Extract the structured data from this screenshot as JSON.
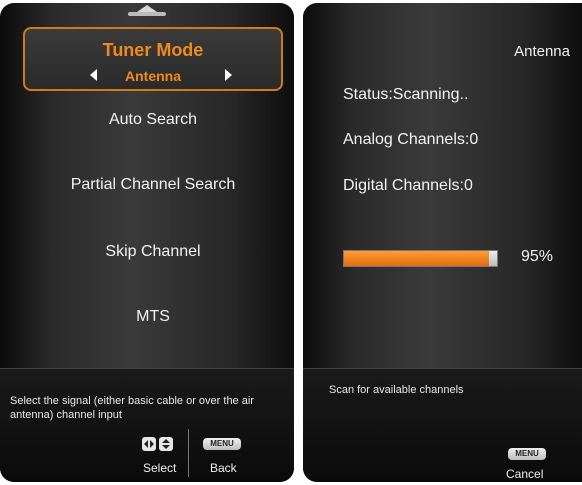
{
  "left_panel": {
    "tuner_mode": {
      "title": "Tuner Mode",
      "value": "Antenna"
    },
    "menu_items": [
      "Auto Search",
      "Partial Channel Search",
      "Skip Channel",
      "MTS"
    ],
    "help_text": "Select the signal (either basic cable or over the air antenna) channel input",
    "controls": {
      "select_label": "Select",
      "menu_key_label": "MENU",
      "back_label": "Back"
    }
  },
  "right_panel": {
    "title": "Antenna",
    "status_text": "Status:Scanning..",
    "analog_channels_text": "Analog Channels:0",
    "digital_channels_text": "Digital Channels:0",
    "progress": {
      "value_percent": 95,
      "label": "95%"
    },
    "footer_text": "Scan for available channels",
    "controls": {
      "menu_key_label": "MENU",
      "cancel_label": "Cancel"
    }
  },
  "colors": {
    "accent": "#f08a1c",
    "panel_dark": "#1f1f1f",
    "text": "#f2f2f2"
  },
  "icons": {
    "scroll_up": "chevron-up-icon",
    "left_arrow": "triangle-left-icon",
    "right_arrow": "triangle-right-icon",
    "select_keys": "dpad-icon",
    "menu_key": "menu-key-icon"
  }
}
